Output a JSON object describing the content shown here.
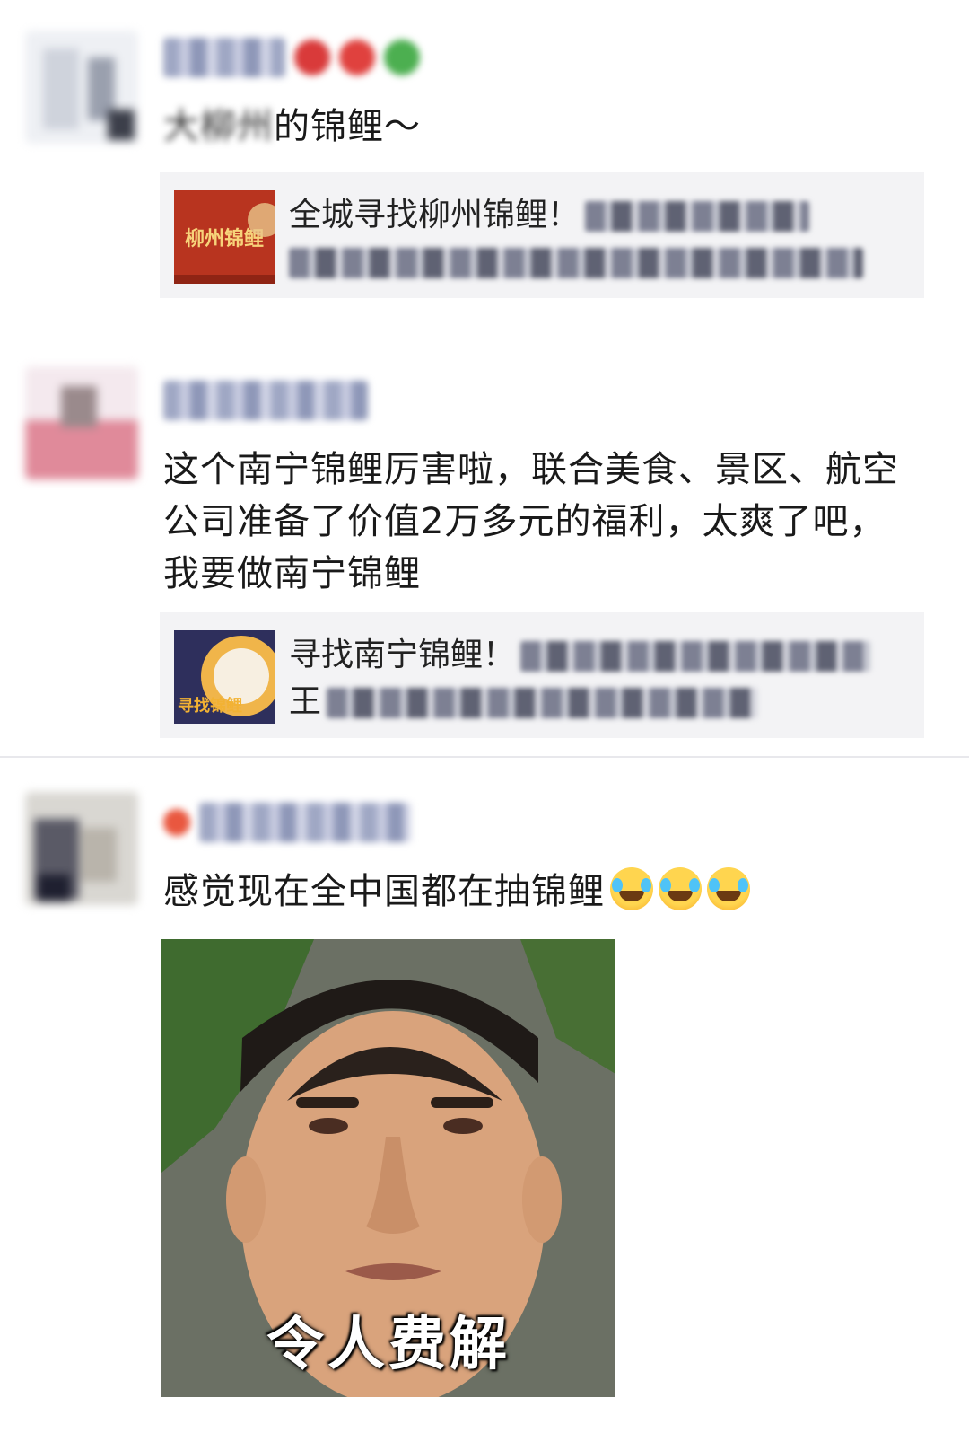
{
  "posts": [
    {
      "comment_prefix_blurred": "大柳州",
      "comment_text": "的锦鲤～",
      "card": {
        "thumb_text": "柳州锦鲤",
        "title": "全城寻找柳州锦鲤！",
        "second_line_prefix": "",
        "colors": {
          "thumb_bg": "#b8341f",
          "thumb_text": "#f7d37a"
        }
      }
    },
    {
      "comment_text": "这个南宁锦鲤厉害啦，联合美食、景区、航空公司准备了价值2万多元的福利，太爽了吧，我要做南宁锦鲤",
      "card": {
        "thumb_text": "寻找锦鲤",
        "title": "寻找南宁锦鲤！",
        "second_line_prefix": "王",
        "colors": {
          "thumb_bg": "#2e2f5c",
          "thumb_text": "#f2b233"
        }
      }
    },
    {
      "comment_text": "感觉现在全中国都在抽锦鲤",
      "emoji": "face-with-tears-of-joy-icon",
      "meme": {
        "caption": "令人费解"
      }
    }
  ]
}
